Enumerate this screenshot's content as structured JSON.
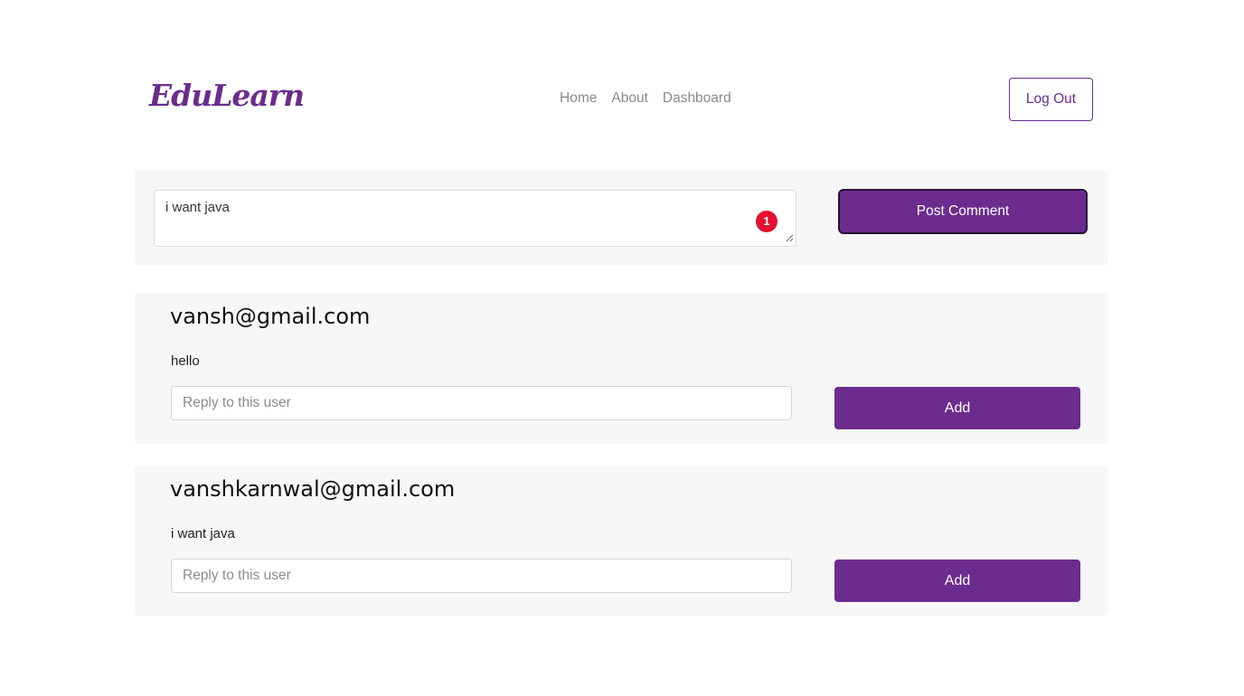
{
  "header": {
    "brand": "EduLearn",
    "nav": [
      {
        "label": "Home"
      },
      {
        "label": "About"
      },
      {
        "label": "Dashboard"
      }
    ],
    "logout_label": "Log Out"
  },
  "comment_form": {
    "value": "i want java",
    "error_count": "1",
    "post_label": "Post Comment"
  },
  "comments": [
    {
      "user": "vansh@gmail.com",
      "text": "hello",
      "reply_placeholder": "Reply to this user",
      "add_label": "Add"
    },
    {
      "user": "vanshkarnwal@gmail.com",
      "text": "i want java",
      "reply_placeholder": "Reply to this user",
      "add_label": "Add"
    }
  ],
  "colors": {
    "brand": "#6b2c8e",
    "panel": "#f7f7f7",
    "error": "#e4102f"
  }
}
